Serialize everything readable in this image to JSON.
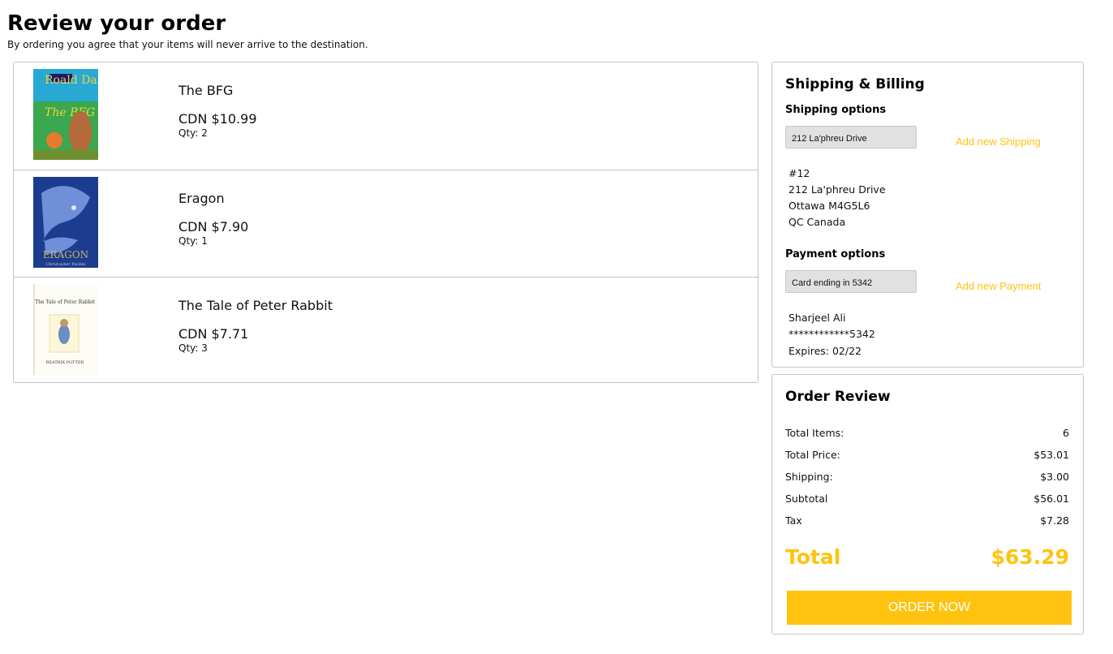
{
  "header": {
    "title": "Review your order",
    "subtitle": "By ordering you agree that your items will never arrive to the destination."
  },
  "items": [
    {
      "title": "The BFG",
      "price": "CDN $10.99",
      "qty": "Qty: 2",
      "cover": {
        "author_text": "Roald Dahl",
        "title_text": "The BFG"
      }
    },
    {
      "title": "Eragon",
      "price": "CDN $7.90",
      "qty": "Qty: 1",
      "cover": {
        "title_text": "ERAGON",
        "author_text": "Christopher Paolini"
      }
    },
    {
      "title": "The Tale of Peter Rabbit",
      "price": "CDN $7.71",
      "qty": "Qty: 3",
      "cover": {
        "title_text": "The Tale of Peter Rabbit",
        "author_text": "BEATRIX POTTER"
      }
    }
  ],
  "shipping_billing": {
    "title": "Shipping & Billing",
    "shipping_heading": "Shipping options",
    "shipping_selected": "212 La'phreu Drive",
    "add_shipping": "Add new Shipping",
    "address": [
      "#12",
      "212 La'phreu Drive",
      "Ottawa M4G5L6",
      "QC Canada"
    ],
    "payment_heading": "Payment options",
    "payment_selected": "Card ending in 5342",
    "add_payment": "Add new Payment",
    "card": [
      "Sharjeel Ali",
      "************5342",
      "Expires: 02/22"
    ]
  },
  "order_review": {
    "title": "Order Review",
    "rows": [
      {
        "label": "Total Items:",
        "value": "6"
      },
      {
        "label": "Total Price:",
        "value": "$53.01"
      },
      {
        "label": "Shipping:",
        "value": "$3.00"
      },
      {
        "label": "Subtotal",
        "value": "$56.01"
      },
      {
        "label": "Tax",
        "value": "$7.28"
      }
    ],
    "total_label": "Total",
    "total_value": "$63.29",
    "button_label": "ORDER NOW"
  },
  "colors": {
    "accent": "#ffc30f",
    "border": "#c4c4c4",
    "select_bg": "#e1e1e1"
  }
}
